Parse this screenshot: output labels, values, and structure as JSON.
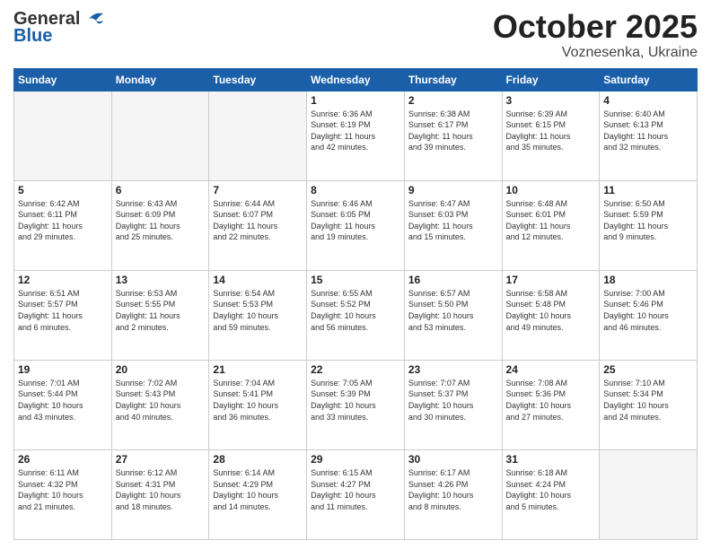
{
  "header": {
    "logo_general": "General",
    "logo_blue": "Blue",
    "month": "October 2025",
    "location": "Voznesenka, Ukraine"
  },
  "weekdays": [
    "Sunday",
    "Monday",
    "Tuesday",
    "Wednesday",
    "Thursday",
    "Friday",
    "Saturday"
  ],
  "weeks": [
    [
      {
        "day": "",
        "info": ""
      },
      {
        "day": "",
        "info": ""
      },
      {
        "day": "",
        "info": ""
      },
      {
        "day": "1",
        "info": "Sunrise: 6:36 AM\nSunset: 6:19 PM\nDaylight: 11 hours\nand 42 minutes."
      },
      {
        "day": "2",
        "info": "Sunrise: 6:38 AM\nSunset: 6:17 PM\nDaylight: 11 hours\nand 39 minutes."
      },
      {
        "day": "3",
        "info": "Sunrise: 6:39 AM\nSunset: 6:15 PM\nDaylight: 11 hours\nand 35 minutes."
      },
      {
        "day": "4",
        "info": "Sunrise: 6:40 AM\nSunset: 6:13 PM\nDaylight: 11 hours\nand 32 minutes."
      }
    ],
    [
      {
        "day": "5",
        "info": "Sunrise: 6:42 AM\nSunset: 6:11 PM\nDaylight: 11 hours\nand 29 minutes."
      },
      {
        "day": "6",
        "info": "Sunrise: 6:43 AM\nSunset: 6:09 PM\nDaylight: 11 hours\nand 25 minutes."
      },
      {
        "day": "7",
        "info": "Sunrise: 6:44 AM\nSunset: 6:07 PM\nDaylight: 11 hours\nand 22 minutes."
      },
      {
        "day": "8",
        "info": "Sunrise: 6:46 AM\nSunset: 6:05 PM\nDaylight: 11 hours\nand 19 minutes."
      },
      {
        "day": "9",
        "info": "Sunrise: 6:47 AM\nSunset: 6:03 PM\nDaylight: 11 hours\nand 15 minutes."
      },
      {
        "day": "10",
        "info": "Sunrise: 6:48 AM\nSunset: 6:01 PM\nDaylight: 11 hours\nand 12 minutes."
      },
      {
        "day": "11",
        "info": "Sunrise: 6:50 AM\nSunset: 5:59 PM\nDaylight: 11 hours\nand 9 minutes."
      }
    ],
    [
      {
        "day": "12",
        "info": "Sunrise: 6:51 AM\nSunset: 5:57 PM\nDaylight: 11 hours\nand 6 minutes."
      },
      {
        "day": "13",
        "info": "Sunrise: 6:53 AM\nSunset: 5:55 PM\nDaylight: 11 hours\nand 2 minutes."
      },
      {
        "day": "14",
        "info": "Sunrise: 6:54 AM\nSunset: 5:53 PM\nDaylight: 10 hours\nand 59 minutes."
      },
      {
        "day": "15",
        "info": "Sunrise: 6:55 AM\nSunset: 5:52 PM\nDaylight: 10 hours\nand 56 minutes."
      },
      {
        "day": "16",
        "info": "Sunrise: 6:57 AM\nSunset: 5:50 PM\nDaylight: 10 hours\nand 53 minutes."
      },
      {
        "day": "17",
        "info": "Sunrise: 6:58 AM\nSunset: 5:48 PM\nDaylight: 10 hours\nand 49 minutes."
      },
      {
        "day": "18",
        "info": "Sunrise: 7:00 AM\nSunset: 5:46 PM\nDaylight: 10 hours\nand 46 minutes."
      }
    ],
    [
      {
        "day": "19",
        "info": "Sunrise: 7:01 AM\nSunset: 5:44 PM\nDaylight: 10 hours\nand 43 minutes."
      },
      {
        "day": "20",
        "info": "Sunrise: 7:02 AM\nSunset: 5:43 PM\nDaylight: 10 hours\nand 40 minutes."
      },
      {
        "day": "21",
        "info": "Sunrise: 7:04 AM\nSunset: 5:41 PM\nDaylight: 10 hours\nand 36 minutes."
      },
      {
        "day": "22",
        "info": "Sunrise: 7:05 AM\nSunset: 5:39 PM\nDaylight: 10 hours\nand 33 minutes."
      },
      {
        "day": "23",
        "info": "Sunrise: 7:07 AM\nSunset: 5:37 PM\nDaylight: 10 hours\nand 30 minutes."
      },
      {
        "day": "24",
        "info": "Sunrise: 7:08 AM\nSunset: 5:36 PM\nDaylight: 10 hours\nand 27 minutes."
      },
      {
        "day": "25",
        "info": "Sunrise: 7:10 AM\nSunset: 5:34 PM\nDaylight: 10 hours\nand 24 minutes."
      }
    ],
    [
      {
        "day": "26",
        "info": "Sunrise: 6:11 AM\nSunset: 4:32 PM\nDaylight: 10 hours\nand 21 minutes."
      },
      {
        "day": "27",
        "info": "Sunrise: 6:12 AM\nSunset: 4:31 PM\nDaylight: 10 hours\nand 18 minutes."
      },
      {
        "day": "28",
        "info": "Sunrise: 6:14 AM\nSunset: 4:29 PM\nDaylight: 10 hours\nand 14 minutes."
      },
      {
        "day": "29",
        "info": "Sunrise: 6:15 AM\nSunset: 4:27 PM\nDaylight: 10 hours\nand 11 minutes."
      },
      {
        "day": "30",
        "info": "Sunrise: 6:17 AM\nSunset: 4:26 PM\nDaylight: 10 hours\nand 8 minutes."
      },
      {
        "day": "31",
        "info": "Sunrise: 6:18 AM\nSunset: 4:24 PM\nDaylight: 10 hours\nand 5 minutes."
      },
      {
        "day": "",
        "info": ""
      }
    ]
  ]
}
